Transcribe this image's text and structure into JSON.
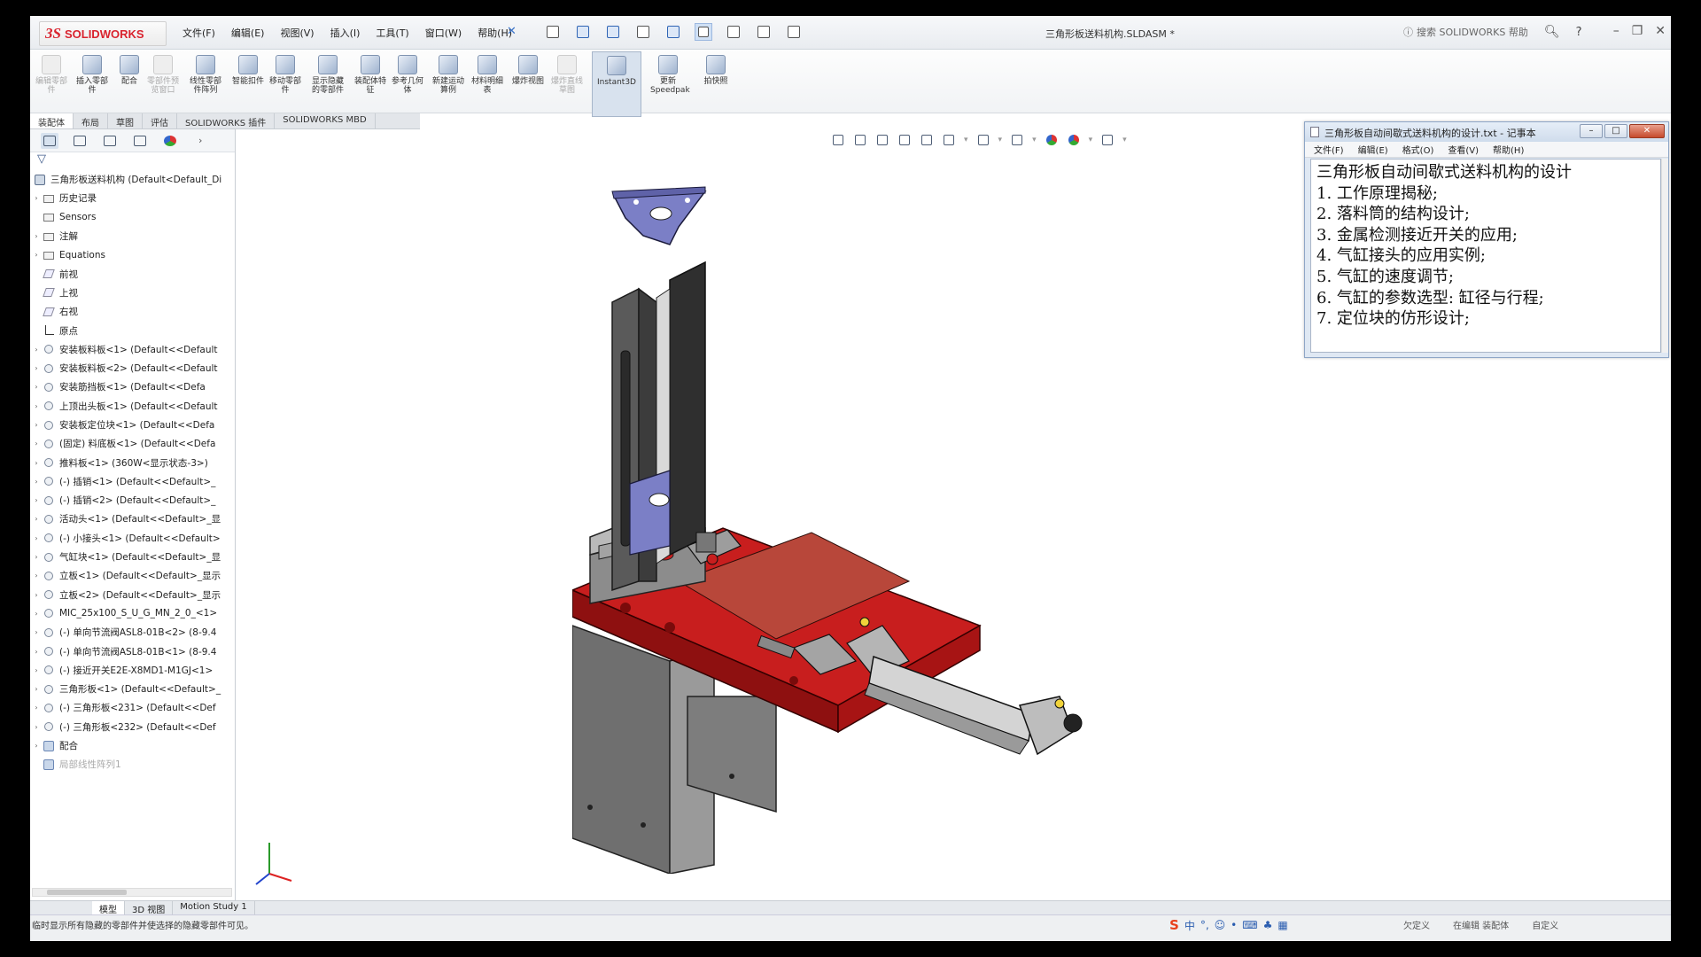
{
  "app": {
    "brand_ds": "3S",
    "brand_name": "SOLIDWORKS",
    "document_title": "三角形板送料机构.SLDASM *",
    "help_search": "搜索 SOLIDWORKS 帮助"
  },
  "menu": [
    "文件(F)",
    "编辑(E)",
    "视图(V)",
    "插入(I)",
    "工具(T)",
    "窗口(W)",
    "帮助(H)"
  ],
  "commands": [
    {
      "label": "编辑零部件",
      "disabled": true
    },
    {
      "label": "插入零部件",
      "disabled": false
    },
    {
      "label": "配合",
      "disabled": false
    },
    {
      "label": "零部件预览窗口",
      "disabled": true
    },
    {
      "label": "线性零部件阵列",
      "disabled": false
    },
    {
      "label": "智能扣件",
      "disabled": false
    },
    {
      "label": "移动零部件",
      "disabled": false
    },
    {
      "label": "显示隐藏的零部件",
      "disabled": false
    },
    {
      "label": "装配体特征",
      "disabled": false
    },
    {
      "label": "参考几何体",
      "disabled": false
    },
    {
      "label": "新建运动算例",
      "disabled": false
    },
    {
      "label": "材料明细表",
      "disabled": false
    },
    {
      "label": "爆炸视图",
      "disabled": false
    },
    {
      "label": "爆炸直线草图",
      "disabled": true
    },
    {
      "label": "Instant3D",
      "disabled": false
    },
    {
      "label": "更新Speedpak",
      "disabled": false
    },
    {
      "label": "拍快照",
      "disabled": false
    }
  ],
  "tabs": [
    "装配体",
    "布局",
    "草图",
    "评估",
    "SOLIDWORKS 插件",
    "SOLIDWORKS MBD"
  ],
  "tree": {
    "root": "三角形板送料机构  (Default<Default_Di",
    "items": [
      {
        "label": "历史记录",
        "icon": "folder",
        "expand": true
      },
      {
        "label": "Sensors",
        "icon": "folder",
        "expand": false
      },
      {
        "label": "注解",
        "icon": "folder",
        "expand": true
      },
      {
        "label": "Equations",
        "icon": "folder",
        "expand": true
      },
      {
        "label": "前视",
        "icon": "plane",
        "expand": false
      },
      {
        "label": "上视",
        "icon": "plane",
        "expand": false
      },
      {
        "label": "右视",
        "icon": "plane",
        "expand": false
      },
      {
        "label": "原点",
        "icon": "origin",
        "expand": false
      },
      {
        "label": "安装板料板<1> (Default<<Default",
        "icon": "part",
        "expand": true
      },
      {
        "label": "安装板料板<2> (Default<<Default",
        "icon": "part",
        "expand": true
      },
      {
        "label": "安装筋挡板<1> (Default<<Defa",
        "icon": "part",
        "expand": true
      },
      {
        "label": "上顶出头板<1> (Default<<Default",
        "icon": "part",
        "expand": true
      },
      {
        "label": "安装板定位块<1> (Default<<Defa",
        "icon": "part",
        "expand": true
      },
      {
        "label": "(固定) 料底板<1> (Default<<Defa",
        "icon": "part",
        "expand": true
      },
      {
        "label": "推料板<1> (360W<显示状态-3>)",
        "icon": "part",
        "expand": true
      },
      {
        "label": "(-) 插销<1> (Default<<Default>_",
        "icon": "part",
        "expand": true
      },
      {
        "label": "(-) 插销<2> (Default<<Default>_",
        "icon": "part",
        "expand": true
      },
      {
        "label": "活动头<1> (Default<<Default>_显",
        "icon": "part",
        "expand": true
      },
      {
        "label": "(-) 小接头<1> (Default<<Default>",
        "icon": "part",
        "expand": true
      },
      {
        "label": "气缸块<1> (Default<<Default>_显",
        "icon": "part",
        "expand": true
      },
      {
        "label": "立板<1> (Default<<Default>_显示",
        "icon": "part",
        "expand": true
      },
      {
        "label": "立板<2> (Default<<Default>_显示",
        "icon": "part",
        "expand": true
      },
      {
        "label": "MIC_25x100_S_U_G_MN_2_0_<1>",
        "icon": "part",
        "expand": true
      },
      {
        "label": "(-) 单向节流阀ASL8-01B<2> (8-9.4",
        "icon": "part",
        "expand": true
      },
      {
        "label": "(-) 单向节流阀ASL8-01B<1> (8-9.4",
        "icon": "part",
        "expand": true
      },
      {
        "label": "(-) 接近开关E2E-X8MD1-M1GJ<1>",
        "icon": "part",
        "expand": true
      },
      {
        "label": "三角形板<1> (Default<<Default>_",
        "icon": "part",
        "expand": true
      },
      {
        "label": "(-) 三角形板<231> (Default<<Def",
        "icon": "part",
        "expand": true
      },
      {
        "label": "(-) 三角形板<232> (Default<<Def",
        "icon": "part",
        "expand": true
      },
      {
        "label": "配合",
        "icon": "mate",
        "expand": true
      },
      {
        "label": "局部线性阵列1",
        "icon": "mate",
        "expand": false,
        "dim": true
      }
    ]
  },
  "bottom_tabs": [
    "模型",
    "3D 视图",
    "Motion Study 1"
  ],
  "status": {
    "message": "临时显示所有隐藏的零部件并使选择的隐藏零部件可见。",
    "ime": "中",
    "right": [
      "欠定义",
      "在编辑 装配体",
      "自定义"
    ]
  },
  "notepad": {
    "title": "三角形板自动间歇式送料机构的设计.txt - 记事本",
    "menu": [
      "文件(F)",
      "编辑(E)",
      "格式(O)",
      "查看(V)",
      "帮助(H)"
    ],
    "lines": [
      "三角形板自动间歇式送料机构的设计",
      "1. 工作原理揭秘;",
      "2. 落料筒的结构设计;",
      "3. 金属检测接近开关的应用;",
      "4. 气缸接头的应用实例;",
      "5. 气缸的速度调节;",
      "6. 气缸的参数选型: 缸径与行程;",
      "7. 定位块的仿形设计;"
    ]
  },
  "colors": {
    "accent_red": "#d9232e",
    "model_red": "#c81e1e",
    "model_gray": "#6e6e6e",
    "model_blue": "#7c7fc7"
  }
}
